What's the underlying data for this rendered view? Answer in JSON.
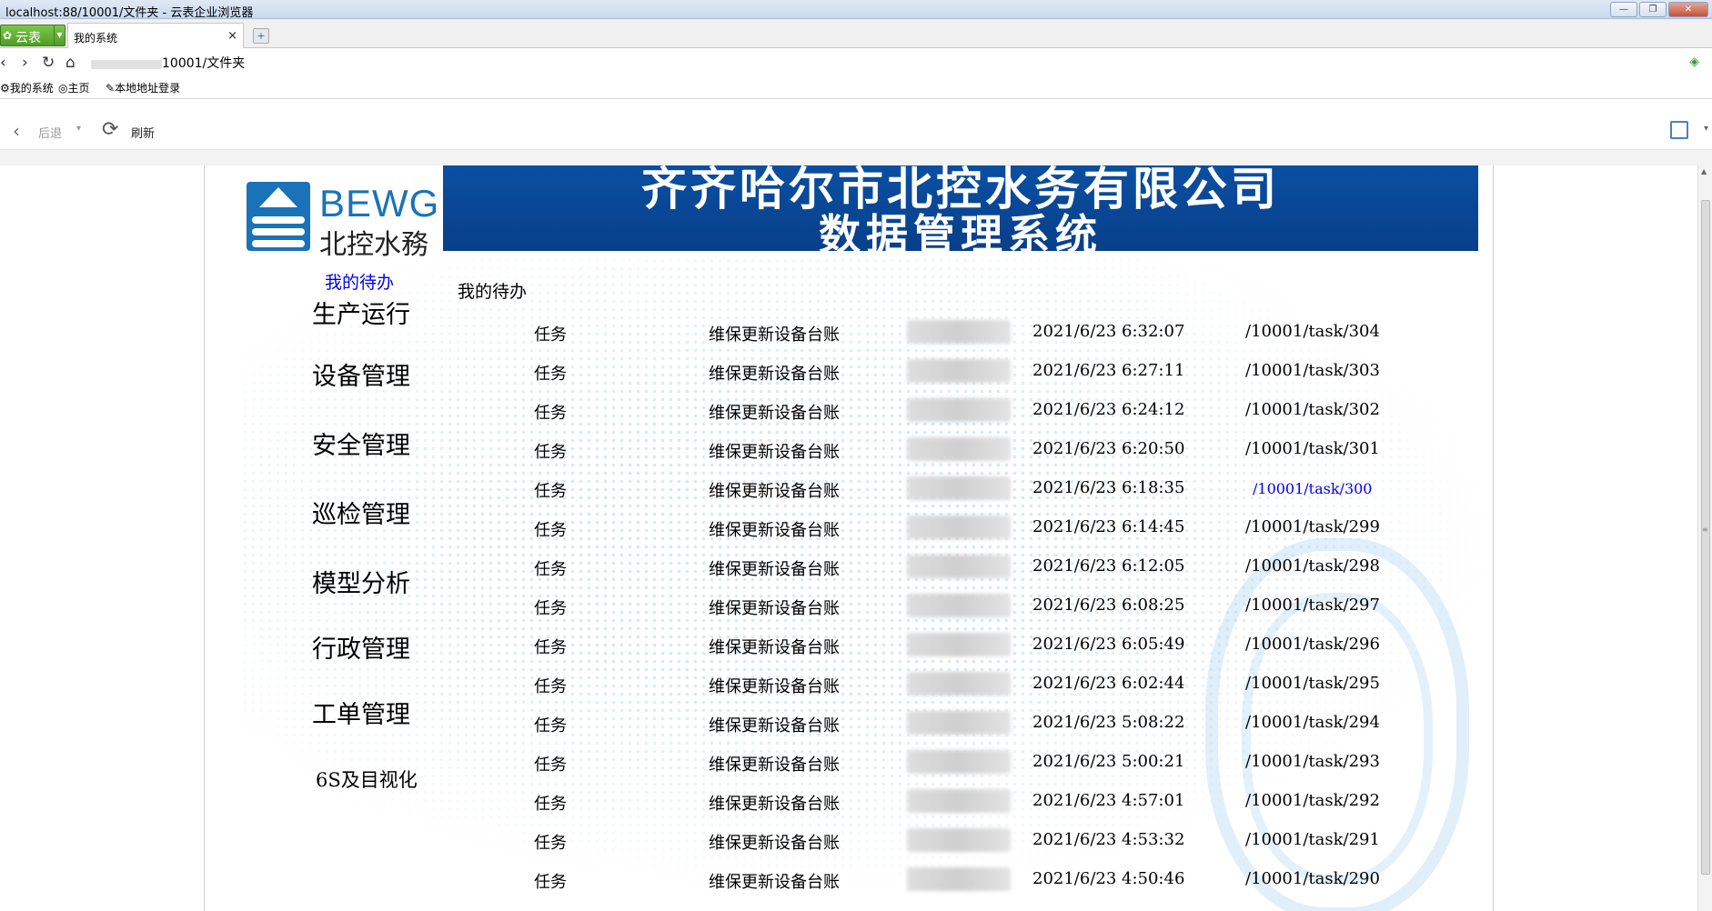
{
  "window": {
    "title": "localhost:88/10001/文件夹 - 云表企业浏览器",
    "minimize": "—",
    "restore": "❐",
    "close": "✕"
  },
  "tabbar": {
    "cloud_label": "云表",
    "tab_label": "我的系统",
    "tab_close": "×",
    "new_tab": "+"
  },
  "address": {
    "url_visible": "10001/文件夹"
  },
  "bookmarks": [
    {
      "label": "我的系统",
      "icon": "gear-icon"
    },
    {
      "label": "主页",
      "icon": "globe-icon"
    },
    {
      "label": "本地地址登录",
      "icon": "wrench-icon"
    }
  ],
  "toolbar": {
    "back_label": "后退",
    "refresh_label": "刷新"
  },
  "banner": {
    "logo_en": "BEWG",
    "logo_cn": "北控水務",
    "title_line1": "齐齐哈尔市北控水务有限公司",
    "title_line2": "数据管理系统"
  },
  "nav": {
    "todo_link": "我的待办",
    "items": [
      "生产运行",
      "设备管理",
      "安全管理",
      "巡检管理",
      "模型分析",
      "行政管理",
      "工单管理",
      "6S及目视化"
    ]
  },
  "main": {
    "section_title": "我的待办",
    "tasks": [
      {
        "type": "任务",
        "name": "维保更新设备台账",
        "time": "2021/6/23 6:32:07",
        "link": "/10001/task/304"
      },
      {
        "type": "任务",
        "name": "维保更新设备台账",
        "time": "2021/6/23 6:27:11",
        "link": "/10001/task/303"
      },
      {
        "type": "任务",
        "name": "维保更新设备台账",
        "time": "2021/6/23 6:24:12",
        "link": "/10001/task/302"
      },
      {
        "type": "任务",
        "name": "维保更新设备台账",
        "time": "2021/6/23 6:20:50",
        "link": "/10001/task/301"
      },
      {
        "type": "任务",
        "name": "维保更新设备台账",
        "time": "2021/6/23 6:18:35",
        "link": "/10001/task/300",
        "visited": true
      },
      {
        "type": "任务",
        "name": "维保更新设备台账",
        "time": "2021/6/23 6:14:45",
        "link": "/10001/task/299"
      },
      {
        "type": "任务",
        "name": "维保更新设备台账",
        "time": "2021/6/23 6:12:05",
        "link": "/10001/task/298"
      },
      {
        "type": "任务",
        "name": "维保更新设备台账",
        "time": "2021/6/23 6:08:25",
        "link": "/10001/task/297"
      },
      {
        "type": "任务",
        "name": "维保更新设备台账",
        "time": "2021/6/23 6:05:49",
        "link": "/10001/task/296"
      },
      {
        "type": "任务",
        "name": "维保更新设备台账",
        "time": "2021/6/23 6:02:44",
        "link": "/10001/task/295"
      },
      {
        "type": "任务",
        "name": "维保更新设备台账",
        "time": "2021/6/23 5:08:22",
        "link": "/10001/task/294"
      },
      {
        "type": "任务",
        "name": "维保更新设备台账",
        "time": "2021/6/23 5:00:21",
        "link": "/10001/task/293"
      },
      {
        "type": "任务",
        "name": "维保更新设备台账",
        "time": "2021/6/23 4:57:01",
        "link": "/10001/task/292"
      },
      {
        "type": "任务",
        "name": "维保更新设备台账",
        "time": "2021/6/23 4:53:32",
        "link": "/10001/task/291"
      },
      {
        "type": "任务",
        "name": "维保更新设备台账",
        "time": "2021/6/23 4:50:46",
        "link": "/10001/task/290"
      }
    ]
  },
  "colors": {
    "banner_blue": "#0a4fa2",
    "logo_blue": "#1a73b8",
    "link_blue": "#0000ee",
    "cloud_green": "#5aa82c"
  }
}
